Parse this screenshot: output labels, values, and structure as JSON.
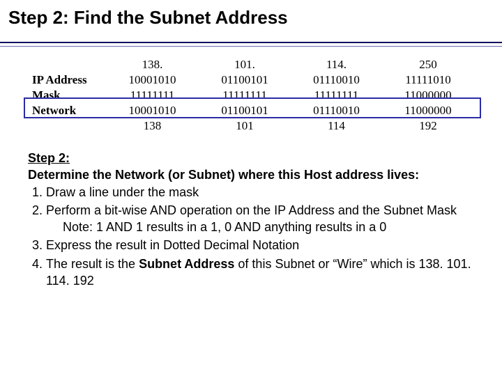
{
  "title": "Step 2: Find the Subnet Address",
  "table": {
    "row_labels": [
      "IP Address",
      "Mask",
      "Network",
      ""
    ],
    "headers": [
      "138.",
      "101.",
      "114.",
      "250"
    ],
    "ip": [
      "10001010",
      "01100101",
      "01110010",
      "11111010"
    ],
    "mask": [
      "11111111",
      "11111111",
      "11111111",
      "11000000"
    ],
    "network": [
      "10001010",
      "01100101",
      "01110010",
      "11000000"
    ],
    "decimal": [
      "138",
      "101",
      "114",
      "192"
    ]
  },
  "body": {
    "step_label": "Step 2:",
    "subhead": "Determine the Network (or Subnet) where this Host address lives:",
    "item1": "Draw a line under the mask",
    "item2": "Perform a bit-wise AND operation on the IP Address and the Subnet Mask",
    "note": "Note:  1 AND 1 results in a 1, 0 AND anything results in a 0",
    "item3": "Express the result in Dotted Decimal Notation",
    "item4_pre": "The result is the ",
    "item4_term": "Subnet Address",
    "item4_post": " of this Subnet or “Wire” which is 138. 101. 114. 192"
  }
}
